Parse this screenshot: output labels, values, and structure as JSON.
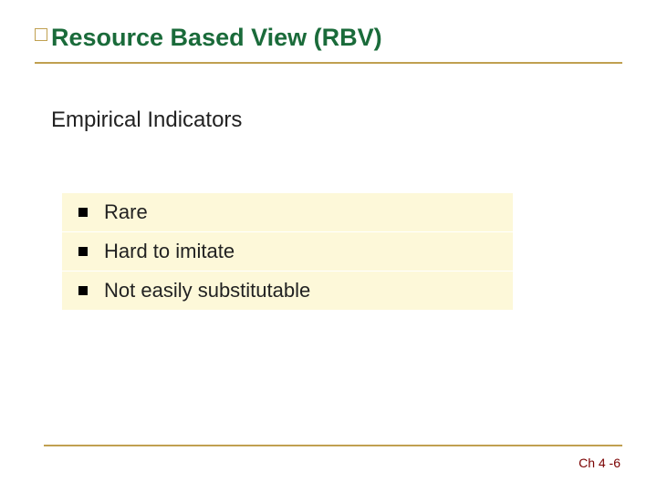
{
  "title": "Resource Based View (RBV)",
  "subtitle": "Empirical Indicators",
  "bullets": [
    "Rare",
    "Hard to imitate",
    "Not easily substitutable"
  ],
  "footer": "Ch 4 -6"
}
